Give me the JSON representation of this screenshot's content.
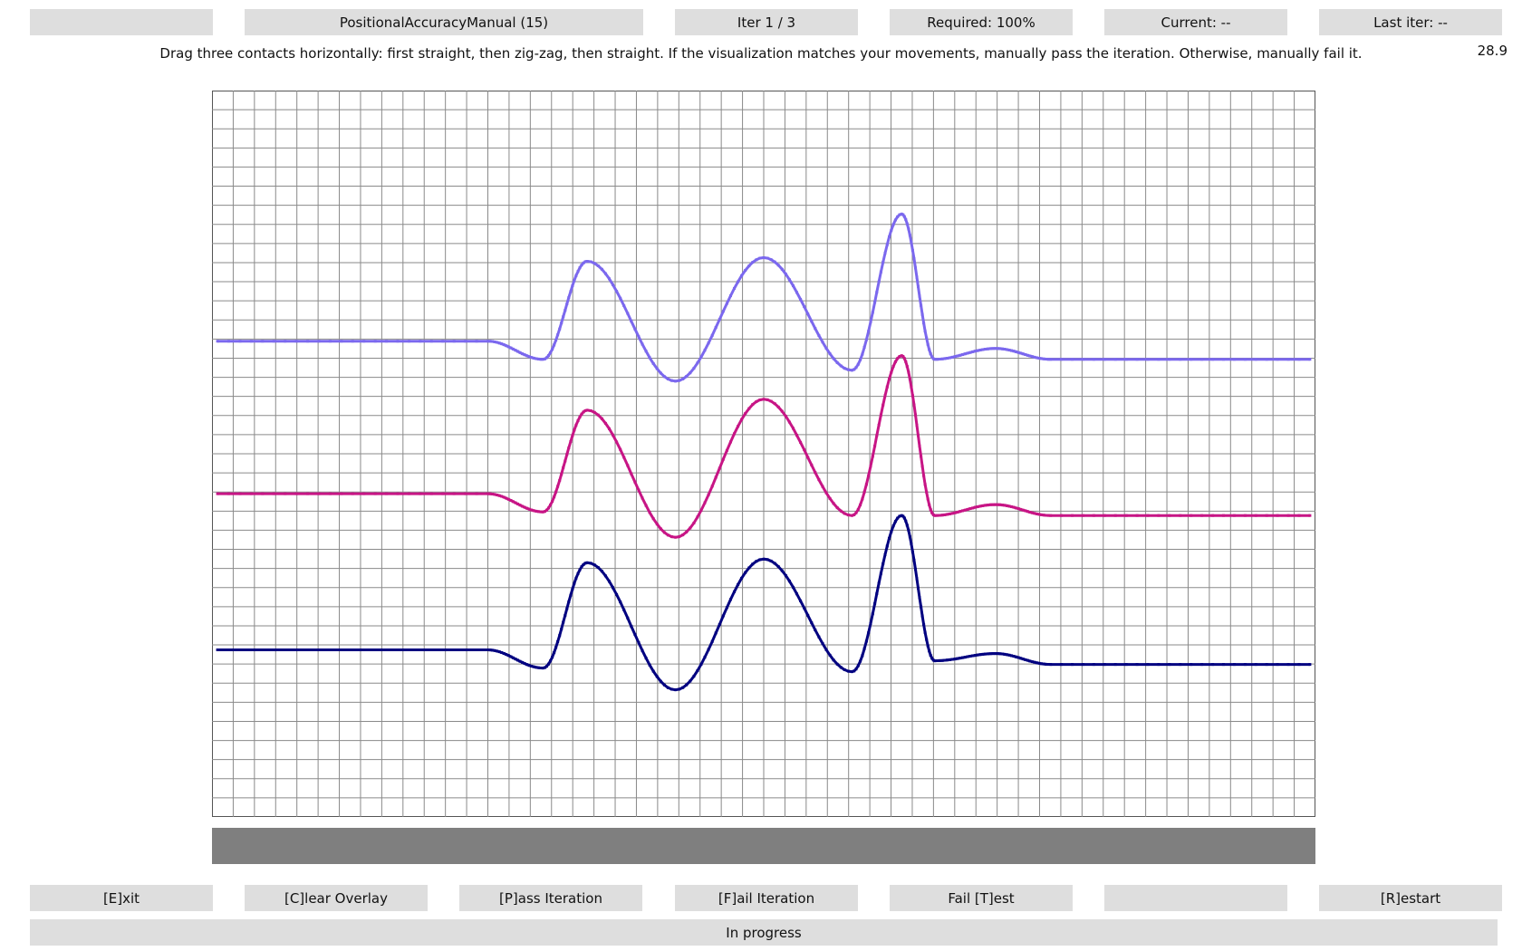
{
  "header": {
    "blank": "",
    "test_name": "PositionalAccuracyManual (15)",
    "iteration": "Iter 1 / 3",
    "required": "Required: 100%",
    "current": "Current: --",
    "last_iter": "Last iter: --"
  },
  "instruction": "Drag three contacts horizontally: first straight, then zig-zag, then straight. If the visualization matches your movements, manually pass the iteration. Otherwise, manually fail it.",
  "fps": "28.9",
  "colors": {
    "grid_line": "#8a8a8a",
    "trace_top": "#7b68ee",
    "trace_middle": "#c71585",
    "trace_bottom": "#000080",
    "button_bg": "#dedede",
    "bar": "#7f7f7f"
  },
  "traces": [
    {
      "color": "#7b68ee",
      "baseline": 0.345,
      "zigzag": [
        0.235,
        0.4,
        0.23,
        0.385,
        0.17,
        0.37
      ],
      "tail": 0.37
    },
    {
      "color": "#c71585",
      "baseline": 0.555,
      "zigzag": [
        0.44,
        0.615,
        0.425,
        0.585,
        0.365,
        0.585
      ],
      "tail": 0.585
    },
    {
      "color": "#000080",
      "baseline": 0.77,
      "zigzag": [
        0.65,
        0.825,
        0.645,
        0.8,
        0.585,
        0.785
      ],
      "tail": 0.79
    }
  ],
  "footer": {
    "exit": "[E]xit",
    "clear": "[C]lear Overlay",
    "pass": "[P]ass Iteration",
    "fail_iter": "[F]ail Iteration",
    "fail_test": "Fail [T]est",
    "empty": "",
    "restart": "[R]estart"
  },
  "status": "In progress"
}
